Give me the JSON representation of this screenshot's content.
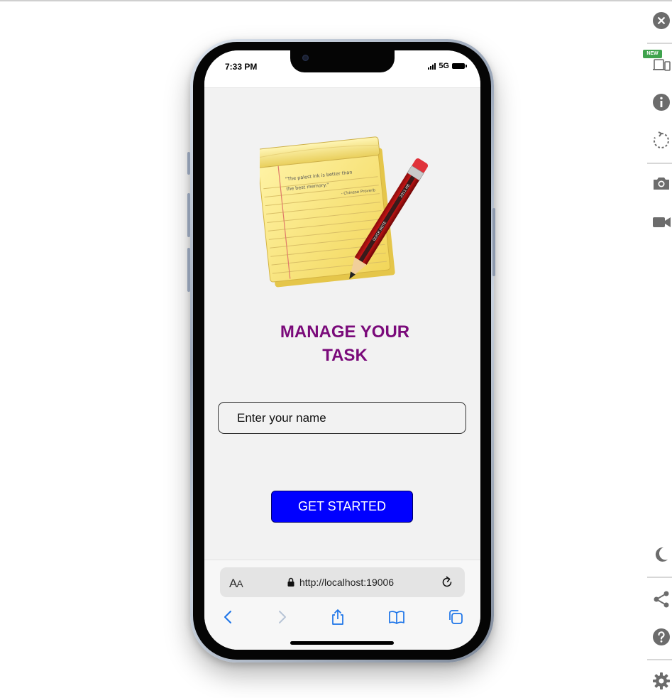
{
  "status_bar": {
    "time": "7:33 PM",
    "network": "5G"
  },
  "app": {
    "title": "MANAGE YOUR\nTASK",
    "name_input": {
      "placeholder": "Enter your name",
      "value": ""
    },
    "start_button_label": "GET STARTED",
    "illustration": {
      "icon": "notepad-pencil-icon",
      "quote_line1": "\"The palest ink is better than",
      "quote_line2": "the best memory.\"",
      "quote_attribution": "- Chinese Proverb",
      "pencil_text_1": "QUICK NOTE",
      "pencil_text_2": "2011 HB"
    }
  },
  "browser": {
    "text_size_label_big": "A",
    "text_size_label_small": "A",
    "url": "http://localhost:19006",
    "icons": [
      "back-icon",
      "forward-icon",
      "share-icon",
      "bookmarks-icon",
      "tabs-icon",
      "reload-icon",
      "lock-icon"
    ]
  },
  "toolbar": {
    "new_badge": "NEW",
    "icons": [
      "close-icon",
      "device-toggle-icon",
      "info-icon",
      "rotate-icon",
      "camera-icon",
      "video-icon",
      "dark-mode-icon",
      "share-icon",
      "help-icon",
      "settings-icon"
    ]
  },
  "colors": {
    "title": "#7a0a7a",
    "button": "#0000ff",
    "screen_bg": "#f2f2f2",
    "ios_blue": "#1a73e8",
    "toolbar_icon": "#6c6c6c",
    "badge": "#3fa34d"
  }
}
